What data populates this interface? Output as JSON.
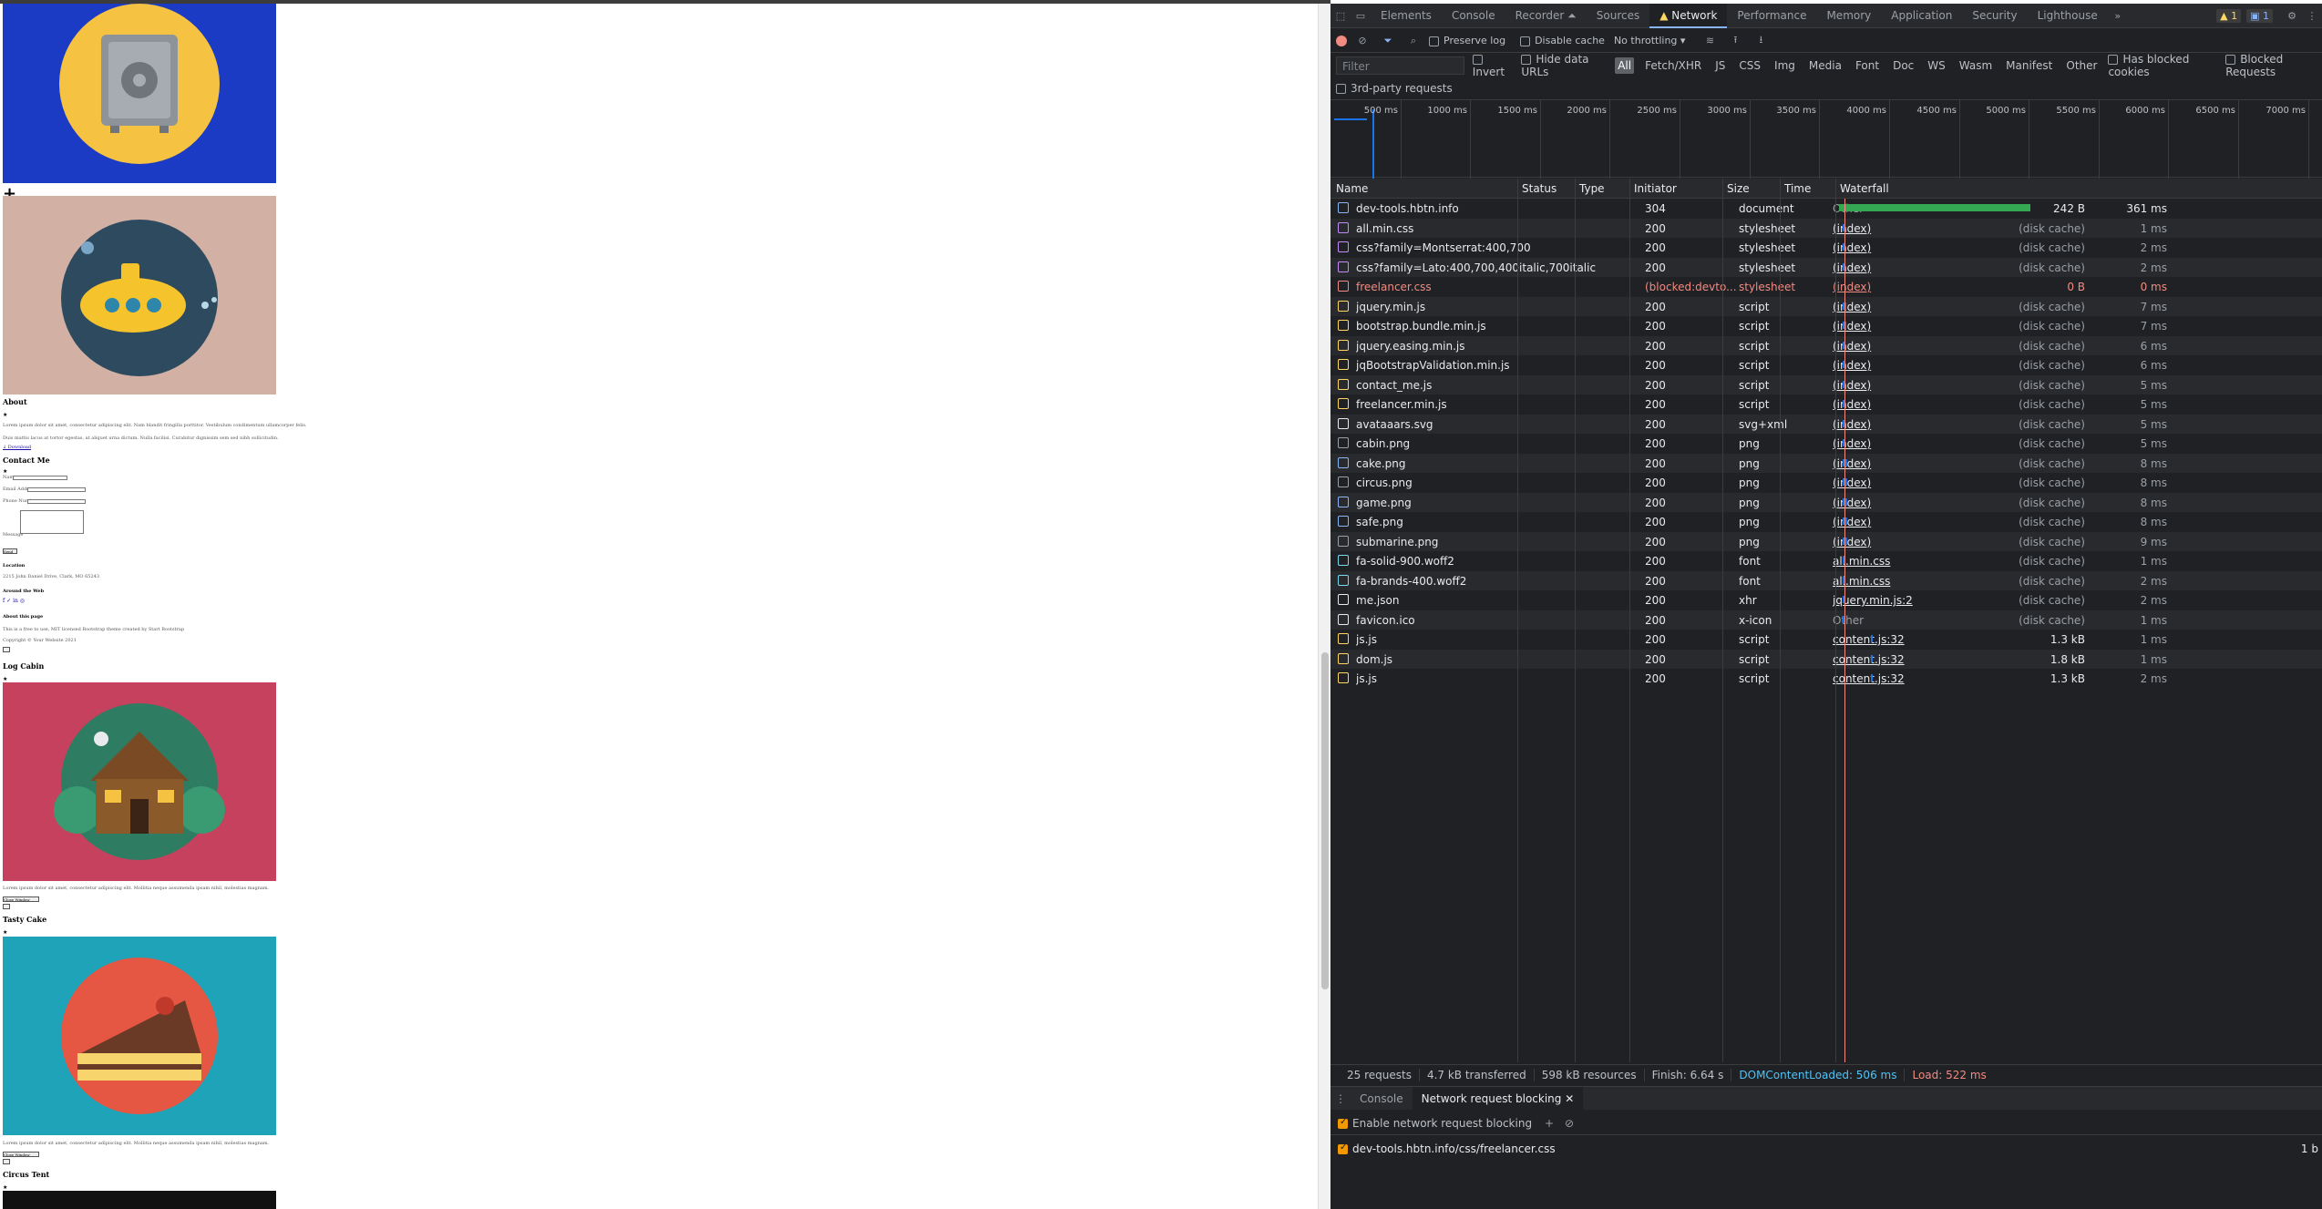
{
  "page": {
    "headings": [
      "About",
      "Contact Me",
      "Log Cabin",
      "Tasty Cake",
      "Circus Tent"
    ],
    "about_line1": "Lorem ipsum dolor sit amet, consectetur adipiscing elit. Nam blandit fringilla porttitor. Vestibulum condimentum ullamcorper felis.",
    "about_line2": "Duis mattis lacus at tortor egestas, at aliquet urna dictum. Nulla facilisi. Curabitur dignissim sem sed nibh sollicitudin.",
    "contact_name": "Name",
    "contact_email": "Email Address",
    "contact_phone": "Phone Number",
    "contact_message": "Message",
    "contact_send": "Send",
    "location_title": "Location",
    "location_line": "2215 John Daniel Drive, Clark, MO 65243",
    "around_title": "Around the Web",
    "about_page_title": "About this page",
    "about_page_line": "This is a free to use, MIT licensed Bootstrap theme created by Start Bootstrap",
    "copyright": "Copyright © Your Website 2021",
    "cabin_text": "Lorem ipsum dolor sit amet, consectetur adipiscing elit. Mollitia neque assumenda ipsam nihil, molestias magnam.",
    "cake_text": "Lorem ipsum dolor sit amet, consectetur adipiscing elit. Mollitia neque assumenda ipsam nihil, molestias magnam.",
    "close_label": "Close Window"
  },
  "devtools": {
    "tabs": [
      "Elements",
      "Console",
      "Recorder ⏶",
      "Sources",
      "Network",
      "Performance",
      "Memory",
      "Application",
      "Security",
      "Lighthouse"
    ],
    "active_tab": "Network",
    "warnings_badge": "1",
    "issues_badge": "1",
    "toolbar": {
      "preserve_log": "Preserve log",
      "disable_cache": "Disable cache",
      "throttling": "No throttling"
    },
    "filter": {
      "placeholder": "Filter",
      "invert": "Invert",
      "hide_data_urls": "Hide data URLs",
      "types": [
        "All",
        "Fetch/XHR",
        "JS",
        "CSS",
        "Img",
        "Media",
        "Font",
        "Doc",
        "WS",
        "Wasm",
        "Manifest",
        "Other"
      ],
      "selected_type": "All",
      "has_blocked_cookies": "Has blocked cookies",
      "blocked_requests": "Blocked Requests",
      "third_party": "3rd-party requests"
    },
    "timeline_ticks": [
      "500 ms",
      "1000 ms",
      "1500 ms",
      "2000 ms",
      "2500 ms",
      "3000 ms",
      "3500 ms",
      "4000 ms",
      "4500 ms",
      "5000 ms",
      "5500 ms",
      "6000 ms",
      "6500 ms",
      "7000 ms"
    ],
    "columns": [
      "Name",
      "Status",
      "Type",
      "Initiator",
      "Size",
      "Time",
      "Waterfall"
    ],
    "requests": [
      {
        "name": "dev-tools.hbtn.info",
        "status": "304",
        "type": "document",
        "initiator": "Other",
        "size": "242 B",
        "time": "361 ms",
        "icon": "document",
        "color": "#8ab4f8",
        "blocked": false,
        "init_link": false
      },
      {
        "name": "all.min.css",
        "status": "200",
        "type": "stylesheet",
        "initiator": "(index)",
        "size": "(disk cache)",
        "time": "1 ms",
        "icon": "stylesheet",
        "color": "#c58af9",
        "blocked": false,
        "init_link": true
      },
      {
        "name": "css?family=Montserrat:400,700",
        "status": "200",
        "type": "stylesheet",
        "initiator": "(index)",
        "size": "(disk cache)",
        "time": "2 ms",
        "icon": "stylesheet",
        "color": "#c58af9",
        "blocked": false,
        "init_link": true
      },
      {
        "name": "css?family=Lato:400,700,400italic,700italic",
        "status": "200",
        "type": "stylesheet",
        "initiator": "(index)",
        "size": "(disk cache)",
        "time": "2 ms",
        "icon": "stylesheet",
        "color": "#c58af9",
        "blocked": false,
        "init_link": true
      },
      {
        "name": "freelancer.css",
        "status": "(blocked:devto...",
        "type": "stylesheet",
        "initiator": "(index)",
        "size": "0 B",
        "time": "0 ms",
        "icon": "stylesheet",
        "color": "#f28b82",
        "blocked": true,
        "init_link": true
      },
      {
        "name": "jquery.min.js",
        "status": "200",
        "type": "script",
        "initiator": "(index)",
        "size": "(disk cache)",
        "time": "7 ms",
        "icon": "script",
        "color": "#fdd663",
        "blocked": false,
        "init_link": true
      },
      {
        "name": "bootstrap.bundle.min.js",
        "status": "200",
        "type": "script",
        "initiator": "(index)",
        "size": "(disk cache)",
        "time": "7 ms",
        "icon": "script",
        "color": "#fdd663",
        "blocked": false,
        "init_link": true
      },
      {
        "name": "jquery.easing.min.js",
        "status": "200",
        "type": "script",
        "initiator": "(index)",
        "size": "(disk cache)",
        "time": "6 ms",
        "icon": "script",
        "color": "#fdd663",
        "blocked": false,
        "init_link": true
      },
      {
        "name": "jqBootstrapValidation.min.js",
        "status": "200",
        "type": "script",
        "initiator": "(index)",
        "size": "(disk cache)",
        "time": "6 ms",
        "icon": "script",
        "color": "#fdd663",
        "blocked": false,
        "init_link": true
      },
      {
        "name": "contact_me.js",
        "status": "200",
        "type": "script",
        "initiator": "(index)",
        "size": "(disk cache)",
        "time": "5 ms",
        "icon": "script",
        "color": "#fdd663",
        "blocked": false,
        "init_link": true
      },
      {
        "name": "freelancer.min.js",
        "status": "200",
        "type": "script",
        "initiator": "(index)",
        "size": "(disk cache)",
        "time": "5 ms",
        "icon": "script",
        "color": "#fdd663",
        "blocked": false,
        "init_link": true
      },
      {
        "name": "avataaars.svg",
        "status": "200",
        "type": "svg+xml",
        "initiator": "(index)",
        "size": "(disk cache)",
        "time": "5 ms",
        "icon": "image",
        "color": "#e8eaed",
        "blocked": false,
        "init_link": true
      },
      {
        "name": "cabin.png",
        "status": "200",
        "type": "png",
        "initiator": "(index)",
        "size": "(disk cache)",
        "time": "5 ms",
        "icon": "image",
        "color": "#9aa0a6",
        "blocked": false,
        "init_link": true
      },
      {
        "name": "cake.png",
        "status": "200",
        "type": "png",
        "initiator": "(index)",
        "size": "(disk cache)",
        "time": "8 ms",
        "icon": "image",
        "color": "#8ab4f8",
        "blocked": false,
        "init_link": true
      },
      {
        "name": "circus.png",
        "status": "200",
        "type": "png",
        "initiator": "(index)",
        "size": "(disk cache)",
        "time": "8 ms",
        "icon": "image",
        "color": "#9aa0a6",
        "blocked": false,
        "init_link": true
      },
      {
        "name": "game.png",
        "status": "200",
        "type": "png",
        "initiator": "(index)",
        "size": "(disk cache)",
        "time": "8 ms",
        "icon": "image",
        "color": "#8ab4f8",
        "blocked": false,
        "init_link": true
      },
      {
        "name": "safe.png",
        "status": "200",
        "type": "png",
        "initiator": "(index)",
        "size": "(disk cache)",
        "time": "8 ms",
        "icon": "image",
        "color": "#8ab4f8",
        "blocked": false,
        "init_link": true
      },
      {
        "name": "submarine.png",
        "status": "200",
        "type": "png",
        "initiator": "(index)",
        "size": "(disk cache)",
        "time": "9 ms",
        "icon": "image",
        "color": "#9aa0a6",
        "blocked": false,
        "init_link": true
      },
      {
        "name": "fa-solid-900.woff2",
        "status": "200",
        "type": "font",
        "initiator": "all.min.css",
        "size": "(disk cache)",
        "time": "1 ms",
        "icon": "font",
        "color": "#78d9ec",
        "blocked": false,
        "init_link": true
      },
      {
        "name": "fa-brands-400.woff2",
        "status": "200",
        "type": "font",
        "initiator": "all.min.css",
        "size": "(disk cache)",
        "time": "2 ms",
        "icon": "font",
        "color": "#78d9ec",
        "blocked": false,
        "init_link": true
      },
      {
        "name": "me.json",
        "status": "200",
        "type": "xhr",
        "initiator": "jquery.min.js:2",
        "size": "(disk cache)",
        "time": "2 ms",
        "icon": "other",
        "color": "#e8eaed",
        "blocked": false,
        "init_link": true
      },
      {
        "name": "favicon.ico",
        "status": "200",
        "type": "x-icon",
        "initiator": "Other",
        "size": "(disk cache)",
        "time": "1 ms",
        "icon": "other",
        "color": "#e8eaed",
        "blocked": false,
        "init_link": false
      },
      {
        "name": "js.js",
        "status": "200",
        "type": "script",
        "initiator": "content.js:32",
        "size": "1.3 kB",
        "time": "1 ms",
        "icon": "script",
        "color": "#fdd663",
        "blocked": false,
        "init_link": true
      },
      {
        "name": "dom.js",
        "status": "200",
        "type": "script",
        "initiator": "content.js:32",
        "size": "1.8 kB",
        "time": "1 ms",
        "icon": "script",
        "color": "#fdd663",
        "blocked": false,
        "init_link": true
      },
      {
        "name": "js.js",
        "status": "200",
        "type": "script",
        "initiator": "content.js:32",
        "size": "1.3 kB",
        "time": "2 ms",
        "icon": "script",
        "color": "#fdd663",
        "blocked": false,
        "init_link": true
      }
    ],
    "summary": {
      "requests": "25 requests",
      "transferred": "4.7 kB transferred",
      "resources": "598 kB resources",
      "finish": "Finish: 6.64 s",
      "dom_loaded": "DOMContentLoaded: 506 ms",
      "load": "Load: 522 ms"
    },
    "drawer": {
      "tabs": [
        "Console",
        "Network request blocking"
      ],
      "active": "Network request blocking",
      "enable_label": "Enable network request blocking",
      "pattern": "dev-tools.hbtn.info/css/freelancer.css",
      "pattern_count": "1 b"
    },
    "colors": {
      "bg": "#202124",
      "blue": "#1a73e8",
      "red": "#f28b82",
      "orange": "#f29900",
      "dcl": "#4fc3f7"
    }
  }
}
